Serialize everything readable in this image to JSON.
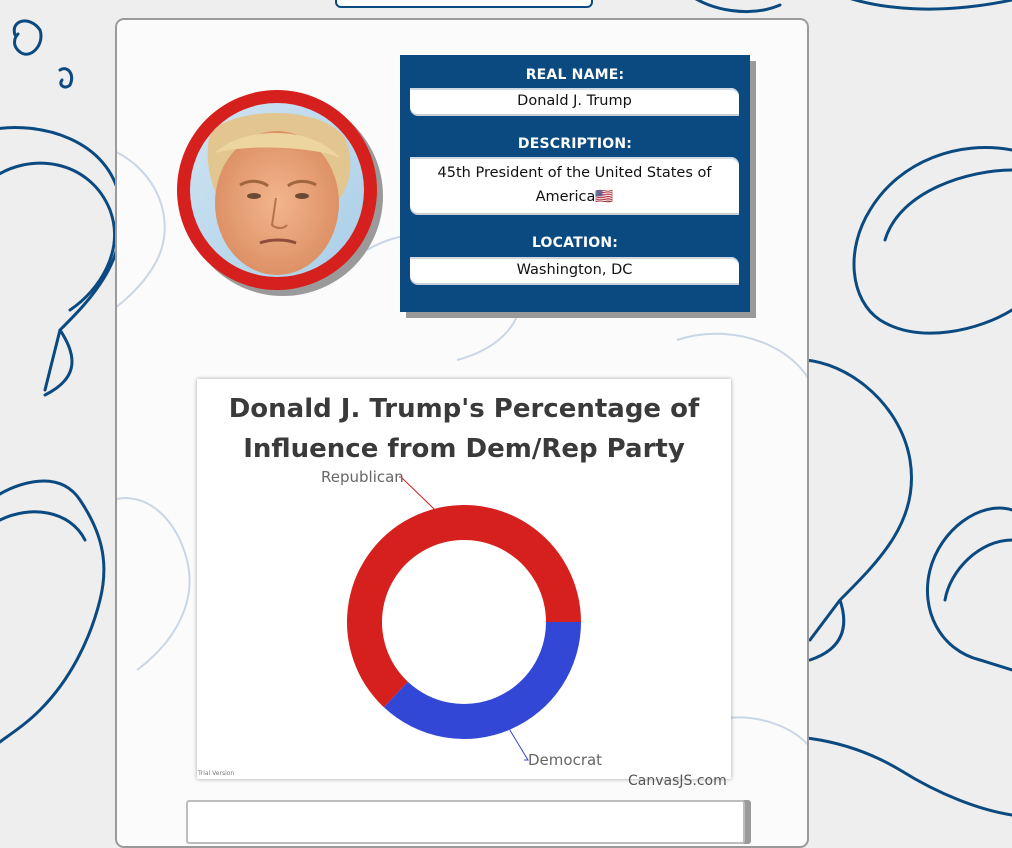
{
  "profile": {
    "name_label": "REAL NAME:",
    "name_value": "Donald J. Trump",
    "description_label": "DESCRIPTION:",
    "description_value": "45th President of the United States of America🇺🇸",
    "location_label": "LOCATION:",
    "location_value": "Washington, DC"
  },
  "colors": {
    "panel_blue": "#0b4a80",
    "avatar_ring_red": "#d6201e",
    "republican_red": "#d6201e",
    "democrat_blue": "#3347d6"
  },
  "chart_data": {
    "type": "pie",
    "style": "doughnut",
    "title": "Donald J. Trump's Percentage of Influence from Dem/Rep Party",
    "categories": [
      "Republican",
      "Democrat"
    ],
    "values": [
      63,
      37
    ],
    "colors": [
      "#d6201e",
      "#3347d6"
    ],
    "legend": "none",
    "index_labels": true
  },
  "footer": {
    "trial_text": "Trial Version",
    "credit_text": "CanvasJS.com"
  }
}
